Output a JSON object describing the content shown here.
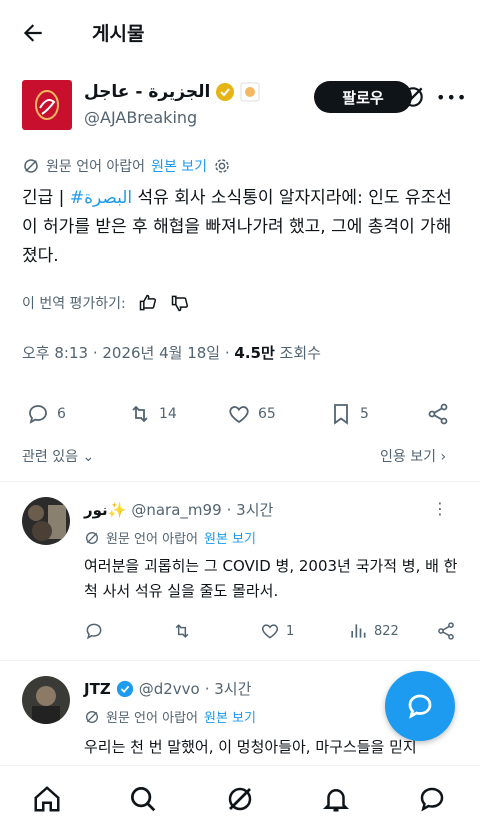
{
  "header": {
    "title": "게시물"
  },
  "post": {
    "author_name": "الجزيرة - عاجل",
    "handle": "@AJABreaking",
    "follow_label": "팔로우",
    "translation_note": "원문 언어 아랍어",
    "view_original": "원본 보기",
    "text_prefix": "긴급 | ",
    "hashtag": "#البصرة",
    "text_body": " 석유 회사 소식통이 알자지라에: 인도 유조선이 허가를 받은 후 해협을 빠져나가려 했고, 그에 총격이 가해졌다.",
    "rate_label": "이 번역 평가하기:",
    "time": "오후 8:13 · 2026년 4월 18일 · ",
    "views": "4.5만",
    "views_label": " 조회수",
    "replies": "6",
    "reposts": "14",
    "likes": "65",
    "bookmarks": "5",
    "related_label": "관련 있음",
    "quote_label": "인용 보기"
  },
  "replies": [
    {
      "name": "نور✨",
      "handle": "@nara_m99",
      "time": "· 3시간",
      "translation_note": "원문 언어 아랍어",
      "view_original": "원본 보기",
      "text": "여러분을 괴롭히는 그 COVID 병, 2003년 국가적 병, 배 한 척 사서 석유 실을 줄도 몰라서.",
      "reply_count": "",
      "repost_count": "",
      "like_count": "1",
      "view_count": "822"
    },
    {
      "name": "JTZ",
      "handle": "@d2vvo",
      "time": "· 3시간",
      "translation_note": "원문 언어 아랍어",
      "view_original": "원본 보기",
      "text": "우리는 천 번 말했어, 이 멍청아들아, 마구스들을 믿지"
    }
  ],
  "colors": {
    "accent": "#1d9bf0",
    "brand": "#c8102e",
    "verified": "#e7b416"
  }
}
